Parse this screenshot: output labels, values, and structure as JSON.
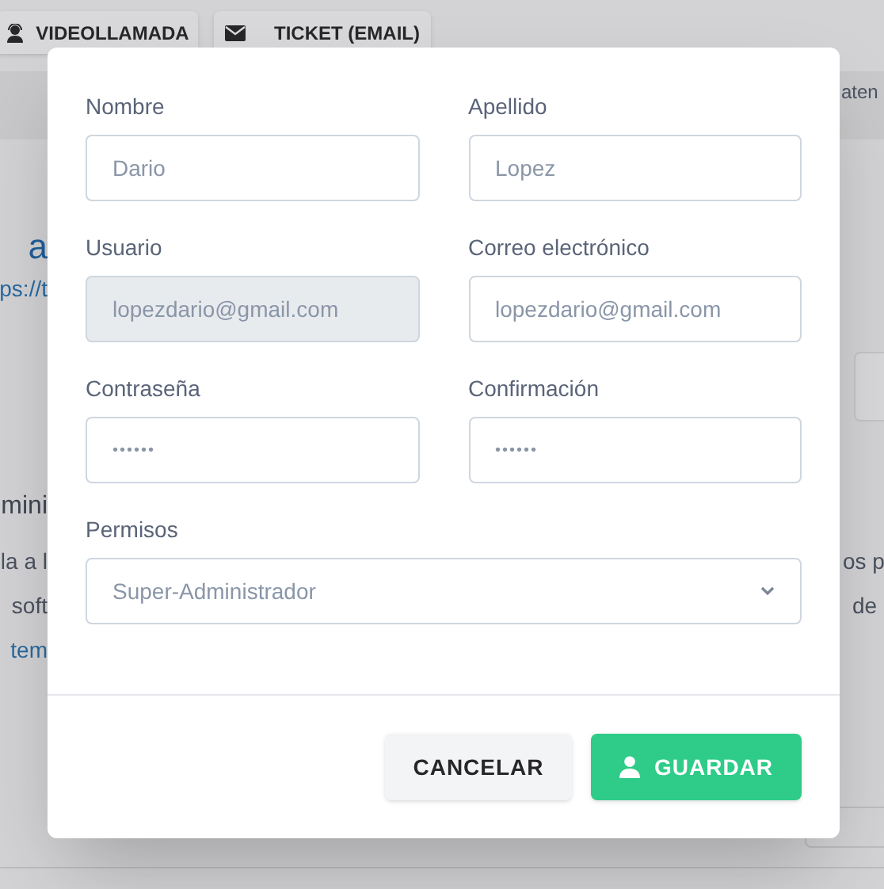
{
  "background": {
    "tabs": [
      {
        "label": "VIDEOLLAMADA",
        "kind": "video"
      },
      {
        "label": "TICKET (EMAIL)",
        "kind": "email"
      }
    ],
    "left_texts": [
      {
        "text": "a",
        "kind": "heading"
      },
      {
        "text": "ps://t",
        "kind": "link"
      },
      {
        "text": "mini",
        "kind": "subheading"
      },
      {
        "text": "la a l",
        "kind": "text"
      },
      {
        "text": "soft",
        "kind": "text"
      },
      {
        "text": "tem",
        "kind": "link"
      }
    ],
    "right_texts": [
      {
        "text": "aten",
        "kind": "small"
      },
      {
        "text": "os p",
        "kind": "text"
      },
      {
        "text": "de",
        "kind": "text"
      }
    ]
  },
  "modal": {
    "fields": [
      {
        "label": "Nombre",
        "value": "Dario",
        "kind": "text",
        "disabled": false
      },
      {
        "label": "Apellido",
        "value": "Lopez",
        "kind": "text",
        "disabled": false
      },
      {
        "label": "Usuario",
        "value": "lopezdario@gmail.com",
        "kind": "text",
        "disabled": true
      },
      {
        "label": "Correo electrónico",
        "value": "lopezdario@gmail.com",
        "kind": "text",
        "disabled": false
      },
      {
        "label": "Contraseña",
        "value": "••••••",
        "kind": "password",
        "disabled": false
      },
      {
        "label": "Confirmación",
        "value": "••••••",
        "kind": "password",
        "disabled": false
      },
      {
        "label": "Permisos",
        "value": "Super-Administrador",
        "kind": "select",
        "disabled": false
      }
    ],
    "buttons": [
      {
        "label": "CANCELAR",
        "kind": "secondary"
      },
      {
        "label": "GUARDAR",
        "kind": "primary"
      }
    ]
  }
}
